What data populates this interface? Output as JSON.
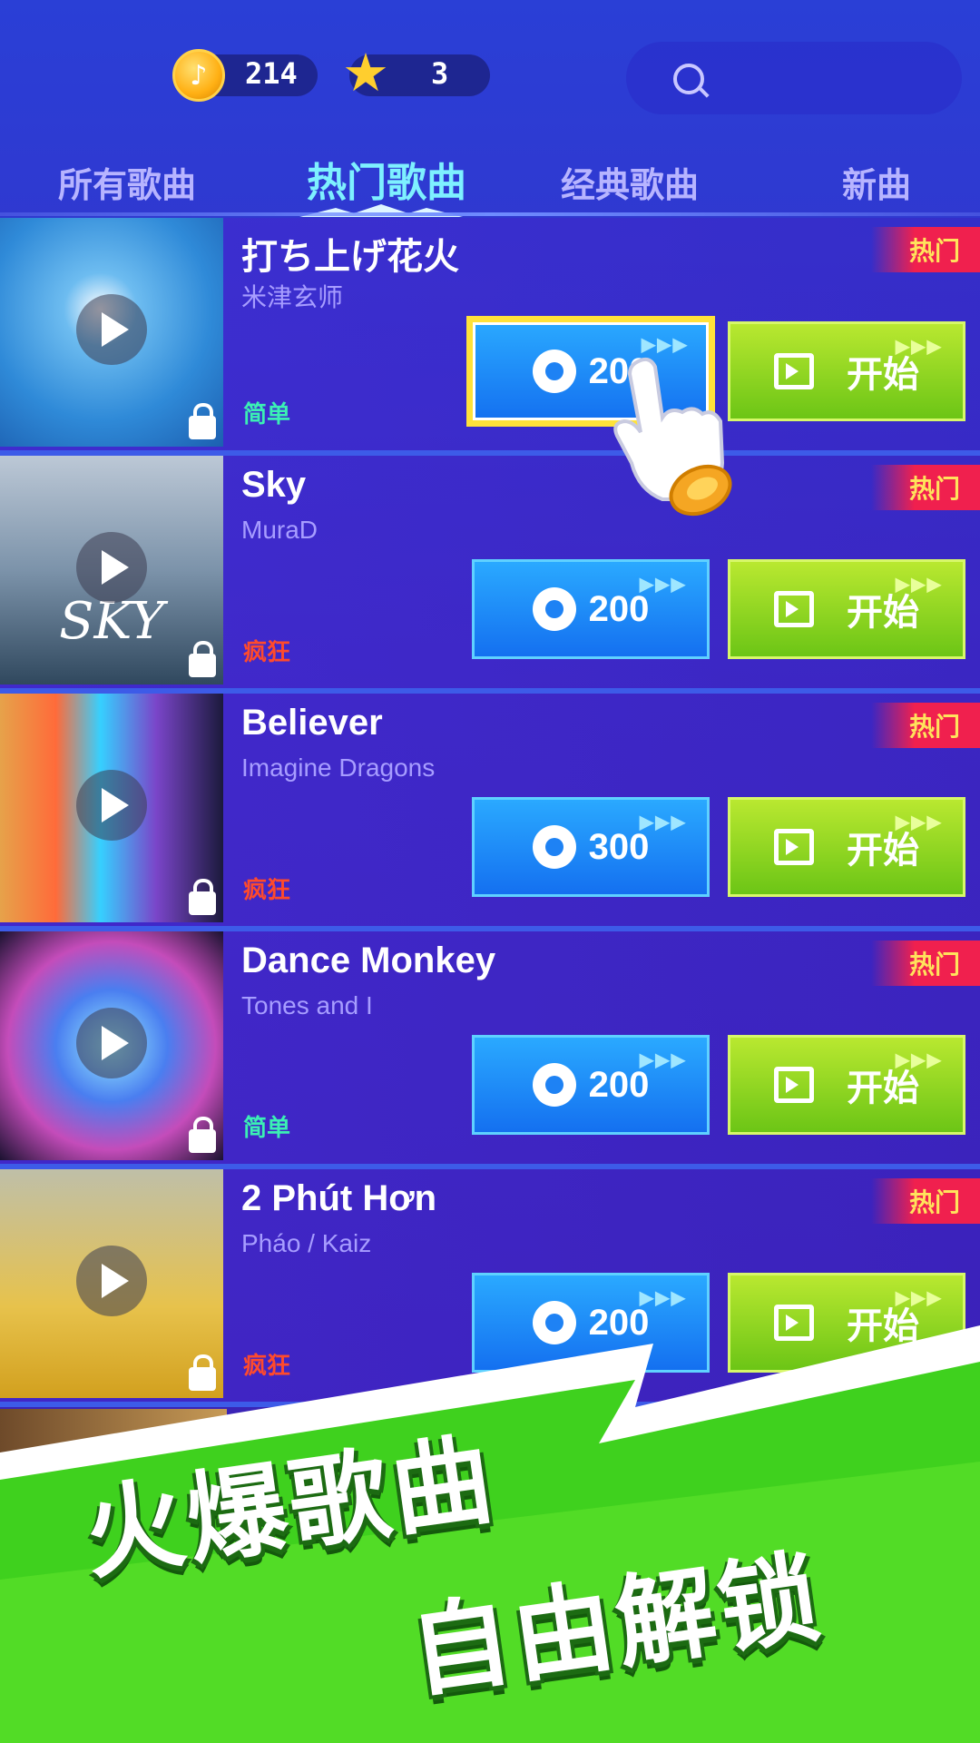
{
  "header": {
    "coin_count": "214",
    "star_count": "3",
    "coin_icon_glyph": "♪"
  },
  "tabs": [
    {
      "label": "所有歌曲",
      "active": false
    },
    {
      "label": "热门歌曲",
      "active": true
    },
    {
      "label": "经典歌曲",
      "active": false
    },
    {
      "label": "新曲",
      "active": false
    }
  ],
  "songs": [
    {
      "title": "打ち上げ花火",
      "artist": "米津玄师",
      "difficulty": "简单",
      "level": "easy",
      "badge": "热门",
      "price": "200",
      "start_label": "开始",
      "cover_text": ""
    },
    {
      "title": "Sky",
      "artist": "MuraD",
      "difficulty": "疯狂",
      "level": "hard",
      "badge": "热门",
      "price": "200",
      "start_label": "开始",
      "cover_text": "SKY"
    },
    {
      "title": "Believer",
      "artist": "Imagine Dragons",
      "difficulty": "疯狂",
      "level": "hard",
      "badge": "热门",
      "price": "300",
      "start_label": "开始",
      "cover_text": ""
    },
    {
      "title": "Dance Monkey",
      "artist": "Tones and I",
      "difficulty": "简单",
      "level": "easy",
      "badge": "热门",
      "price": "200",
      "start_label": "开始",
      "cover_text": ""
    },
    {
      "title": "2 Phút Hơn",
      "artist": "Pháo / Kaiz",
      "difficulty": "疯狂",
      "level": "hard",
      "badge": "热门",
      "price": "200",
      "start_label": "开始",
      "cover_text": ""
    }
  ],
  "arrows_glyph": "▶▶▶",
  "promo": {
    "line1": "火爆歌曲",
    "line2": "自由解锁"
  },
  "colors": {
    "accent_tab": "#7ef0ff",
    "easy": "#3bf0b4",
    "hard": "#ff4a2c",
    "coin_button": "#1e82f4",
    "start_button": "#8fd624",
    "banner_green": "#3fd11e",
    "hot_badge": "#f0204e"
  }
}
